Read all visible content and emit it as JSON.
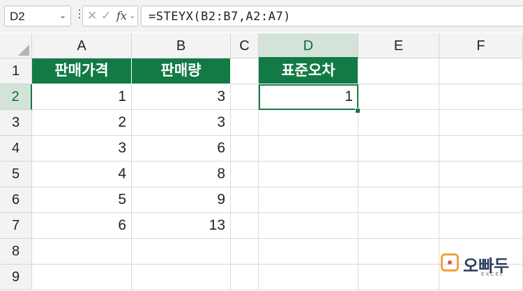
{
  "formula_bar": {
    "name_box": "D2",
    "name_box_arrow": "⌄",
    "dots": "⋮",
    "cancel_icon": "✕",
    "enter_icon": "✓",
    "fx_label": "fx",
    "fx_arrow": "⌄",
    "formula": "=STEYX(B2:B7,A2:A7)"
  },
  "columns": [
    "A",
    "B",
    "C",
    "D",
    "E",
    "F"
  ],
  "rows": [
    "1",
    "2",
    "3",
    "4",
    "5",
    "6",
    "7",
    "8",
    "9"
  ],
  "selected_column": "D",
  "selected_row": "2",
  "sheet": {
    "header_a": "판매가격",
    "header_b": "판매량",
    "header_d": "표준오차",
    "a_values": [
      "1",
      "2",
      "3",
      "4",
      "5",
      "6"
    ],
    "b_values": [
      "3",
      "3",
      "6",
      "8",
      "9",
      "13"
    ],
    "d2_value": "1"
  },
  "colors": {
    "header_fill": "#127a45",
    "selection": "#127a45"
  },
  "watermark": {
    "text": "오빠두",
    "sub": "EXCEL",
    "icon": "camera-logo-icon"
  }
}
